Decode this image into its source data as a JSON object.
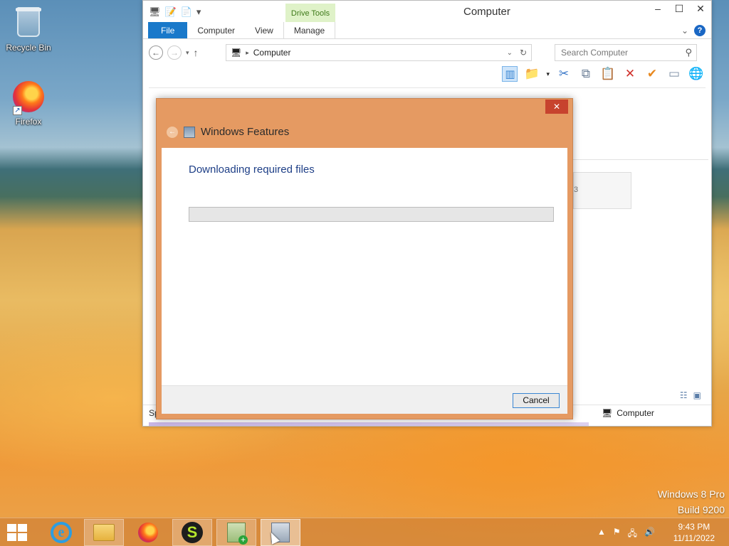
{
  "desktop": {
    "icons": [
      {
        "label": "Recycle Bin",
        "icon": "recycle-bin-icon"
      },
      {
        "label": "Firefox",
        "icon": "firefox-icon"
      }
    ],
    "watermark": {
      "line1": "Windows 8 Pro",
      "line2": "Build 9200"
    }
  },
  "explorer": {
    "title": "Computer",
    "context_tab": "Drive Tools",
    "ribbon_tabs": [
      "File",
      "Computer",
      "View",
      "Manage"
    ],
    "address": "Computer",
    "search_placeholder": "Search Computer",
    "status_left": "Sp",
    "status_right": "Computer",
    "partial_card_text": "3"
  },
  "dialog": {
    "title": "Windows Features",
    "message": "Downloading required files",
    "progress_fraction": 0,
    "cancel_label": "Cancel",
    "close_glyph": "✕"
  },
  "taskbar": {
    "apps": [
      {
        "name": "internet-explorer",
        "open": false
      },
      {
        "name": "file-explorer",
        "open": true
      },
      {
        "name": "firefox",
        "open": false
      },
      {
        "name": "s-app",
        "open": true
      },
      {
        "name": "setup",
        "open": true
      },
      {
        "name": "windows-features",
        "open": true,
        "active": true
      }
    ],
    "clock": {
      "time": "9:43 PM",
      "date": "11/11/2022"
    }
  }
}
